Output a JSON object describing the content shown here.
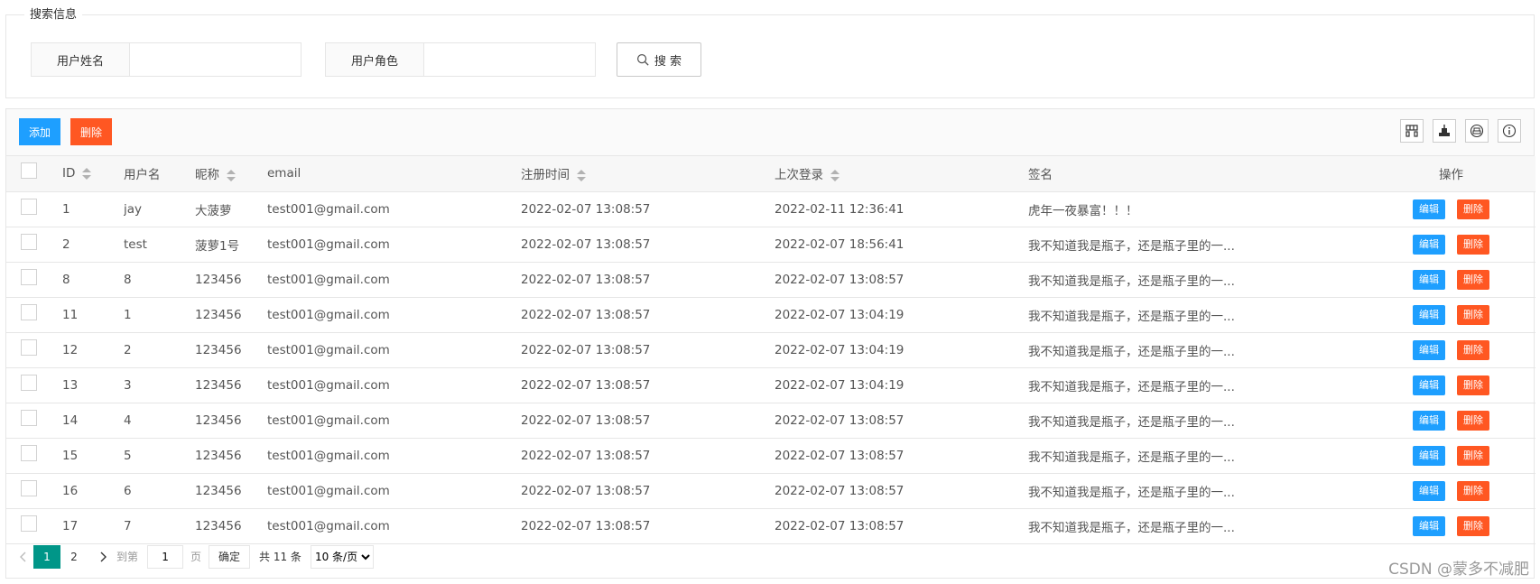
{
  "search": {
    "legend": "搜索信息",
    "username_label": "用户姓名",
    "username_value": "",
    "role_label": "用户角色",
    "role_value": "",
    "search_button": "搜 索"
  },
  "toolbar": {
    "add_label": "添加",
    "delete_label": "删除",
    "icons": [
      "columns-filter-icon",
      "export-icon",
      "print-icon",
      "info-icon"
    ]
  },
  "table": {
    "headers": {
      "id": "ID",
      "username": "用户名",
      "nickname": "昵称",
      "email": "email",
      "register_time": "注册时间",
      "last_login": "上次登录",
      "signature": "签名",
      "actions": "操作"
    },
    "edit_label": "编辑",
    "delete_label": "删除",
    "rows": [
      {
        "id": "1",
        "username": "jay",
        "nickname": "大菠萝",
        "email": "test001@gmail.com",
        "register_time": "2022-02-07 13:08:57",
        "last_login": "2022-02-11 12:36:41",
        "signature": "虎年一夜暴富！！！"
      },
      {
        "id": "2",
        "username": "test",
        "nickname": "菠萝1号",
        "email": "test001@gmail.com",
        "register_time": "2022-02-07 13:08:57",
        "last_login": "2022-02-07 18:56:41",
        "signature": "我不知道我是瓶子，还是瓶子里的一..."
      },
      {
        "id": "8",
        "username": "8",
        "nickname": "123456",
        "email": "test001@gmail.com",
        "register_time": "2022-02-07 13:08:57",
        "last_login": "2022-02-07 13:08:57",
        "signature": "我不知道我是瓶子，还是瓶子里的一..."
      },
      {
        "id": "11",
        "username": "1",
        "nickname": "123456",
        "email": "test001@gmail.com",
        "register_time": "2022-02-07 13:08:57",
        "last_login": "2022-02-07 13:04:19",
        "signature": "我不知道我是瓶子，还是瓶子里的一..."
      },
      {
        "id": "12",
        "username": "2",
        "nickname": "123456",
        "email": "test001@gmail.com",
        "register_time": "2022-02-07 13:08:57",
        "last_login": "2022-02-07 13:04:19",
        "signature": "我不知道我是瓶子，还是瓶子里的一..."
      },
      {
        "id": "13",
        "username": "3",
        "nickname": "123456",
        "email": "test001@gmail.com",
        "register_time": "2022-02-07 13:08:57",
        "last_login": "2022-02-07 13:04:19",
        "signature": "我不知道我是瓶子，还是瓶子里的一..."
      },
      {
        "id": "14",
        "username": "4",
        "nickname": "123456",
        "email": "test001@gmail.com",
        "register_time": "2022-02-07 13:08:57",
        "last_login": "2022-02-07 13:08:57",
        "signature": "我不知道我是瓶子，还是瓶子里的一..."
      },
      {
        "id": "15",
        "username": "5",
        "nickname": "123456",
        "email": "test001@gmail.com",
        "register_time": "2022-02-07 13:08:57",
        "last_login": "2022-02-07 13:08:57",
        "signature": "我不知道我是瓶子，还是瓶子里的一..."
      },
      {
        "id": "16",
        "username": "6",
        "nickname": "123456",
        "email": "test001@gmail.com",
        "register_time": "2022-02-07 13:08:57",
        "last_login": "2022-02-07 13:08:57",
        "signature": "我不知道我是瓶子，还是瓶子里的一..."
      },
      {
        "id": "17",
        "username": "7",
        "nickname": "123456",
        "email": "test001@gmail.com",
        "register_time": "2022-02-07 13:08:57",
        "last_login": "2022-02-07 13:08:57",
        "signature": "我不知道我是瓶子，还是瓶子里的一..."
      }
    ]
  },
  "pager": {
    "pages": [
      "1",
      "2"
    ],
    "current": "1",
    "goto_label": "到第",
    "goto_value": "1",
    "page_unit": "页",
    "confirm_label": "确定",
    "total_label": "共 11 条",
    "page_size": "10 条/页"
  },
  "watermark": "CSDN @蒙多不减肥",
  "colors": {
    "primary": "#1e9fff",
    "danger": "#ff5722",
    "pager_active": "#009688"
  }
}
